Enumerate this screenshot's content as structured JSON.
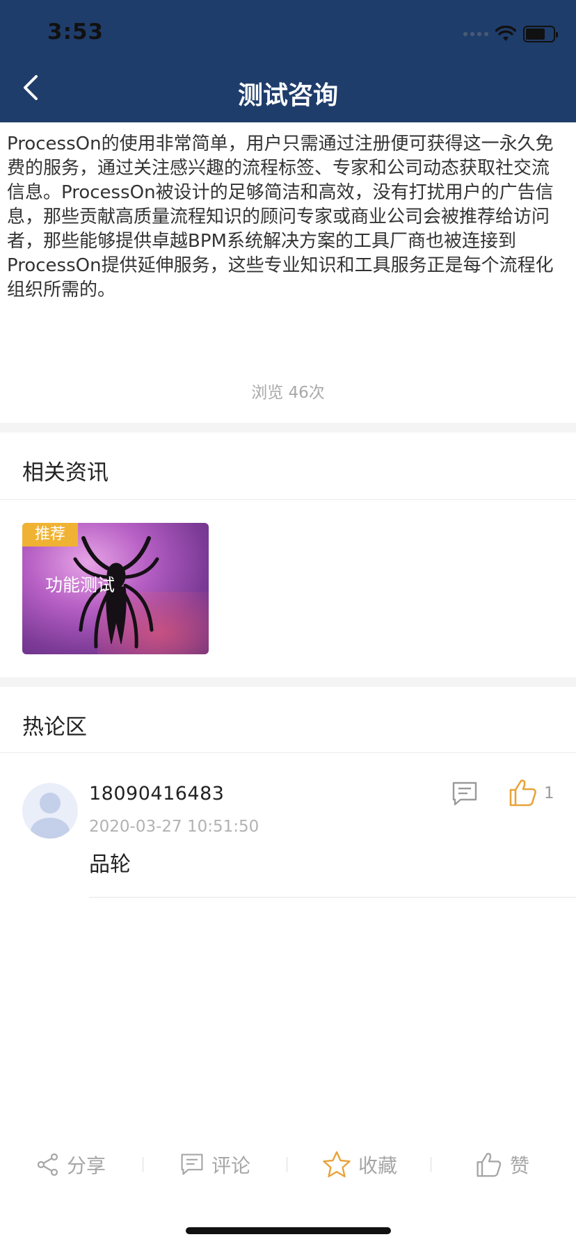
{
  "status_bar": {
    "time": "3:53"
  },
  "nav": {
    "title": "测试咨询"
  },
  "article": {
    "body": "ProcessOn的使用非常简单，用户只需通过注册便可获得这一永久免费的服务，通过关注感兴趣的流程标签、专家和公司动态获取社交流信息。ProcessOn被设计的足够简洁和高效，没有打扰用户的广告信息，那些贡献高质量流程知识的顾问专家或商业公司会被推荐给访问者，那些能够提供卓越BPM系统解决方案的工具厂商也被连接到ProcessOn提供延伸服务，这些专业知识和工具服务正是每个流程化组织所需的。",
    "views": "浏览 46次"
  },
  "related": {
    "title": "相关资讯",
    "cards": [
      {
        "badge": "推荐",
        "label": "功能测试"
      }
    ]
  },
  "comments": {
    "title": "热论区",
    "items": [
      {
        "user": "18090416483",
        "time": "2020-03-27 10:51:50",
        "text": "品轮",
        "likes": "1"
      }
    ]
  },
  "bottom_bar": {
    "share": "分享",
    "comment": "评论",
    "favorite": "收藏",
    "like": "赞"
  },
  "icons": {
    "back": "back-chevron-icon",
    "wifi": "wifi-icon",
    "battery": "battery-icon",
    "reply": "comment-bubble-icon",
    "thumb": "thumbs-up-icon",
    "share": "share-icon",
    "star": "star-icon"
  },
  "colors": {
    "header_bg": "#1f3d6b",
    "accent_orange": "#e8a33a",
    "badge": "#f0b232",
    "muted_text": "#a6a6a6"
  }
}
